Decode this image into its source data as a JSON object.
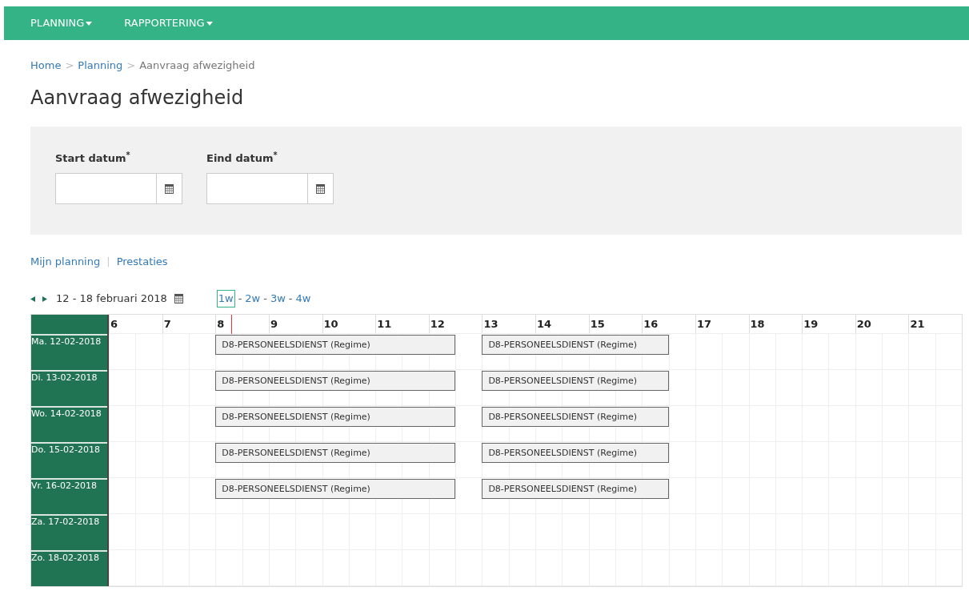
{
  "nav": [
    {
      "label": "PLANNING",
      "dropdown": true
    },
    {
      "label": "RAPPORTERING",
      "dropdown": true
    }
  ],
  "breadcrumb": {
    "separator": ">",
    "items": [
      {
        "label": "Home",
        "link": true
      },
      {
        "label": "Planning",
        "link": true
      },
      {
        "label": "Aanvraag afwezigheid",
        "link": false
      }
    ]
  },
  "title": "Aanvraag afwezigheid",
  "filters": [
    {
      "label": "Start datum$^{*}$"
    },
    {
      "label": "Eind datum$^{*}$"
    }
  ],
  "views": {
    "separator": "|",
    "items": [
      {
        "label": "Mijn planning"
      },
      {
        "label": "Prestaties"
      }
    ]
  },
  "period": {
    "label": "12 - 18 februari 2018",
    "separator": "-",
    "ranges": [
      {
        "label": "1w",
        "selected": true
      },
      {
        "label": "2w",
        "selected": false
      },
      {
        "label": "3w",
        "selected": false
      },
      {
        "label": "4w",
        "selected": false
      }
    ]
  },
  "schedule": {
    "hours": [
      "6",
      "7",
      "8",
      "9",
      "10",
      "11",
      "12",
      "13",
      "14",
      "15",
      "16",
      "17",
      "18",
      "19",
      "20",
      "21"
    ],
    "days": [
      {
        "label": "Ma. 12-02-2018",
        "shifts": [
          {
            "label": "D8-PERSONEELSDIENST (Regime)"
          },
          {
            "label": "D8-PERSONEELSDIENST (Regime)"
          }
        ]
      },
      {
        "label": "Di. 13-02-2018",
        "shifts": [
          {
            "label": "D8-PERSONEELSDIENST (Regime)"
          },
          {
            "label": "D8-PERSONEELSDIENST (Regime)"
          }
        ]
      },
      {
        "label": "Wo. 14-02-2018",
        "shifts": [
          {
            "label": "D8-PERSONEELSDIENST (Regime)"
          },
          {
            "label": "D8-PERSONEELSDIENST (Regime)"
          }
        ]
      },
      {
        "label": "Do. 15-02-2018",
        "shifts": [
          {
            "label": "D8-PERSONEELSDIENST (Regime)"
          },
          {
            "label": "D8-PERSONEELSDIENST (Regime)"
          }
        ]
      },
      {
        "label": "Vr. 16-02-2018",
        "shifts": [
          {
            "label": "D8-PERSONEELSDIENST (Regime)"
          },
          {
            "label": "D8-PERSONEELSDIENST (Regime)"
          }
        ]
      },
      {
        "label": "Za. 17-02-2018"
      },
      {
        "label": "Zo. 18-02-2018"
      }
    ]
  }
}
